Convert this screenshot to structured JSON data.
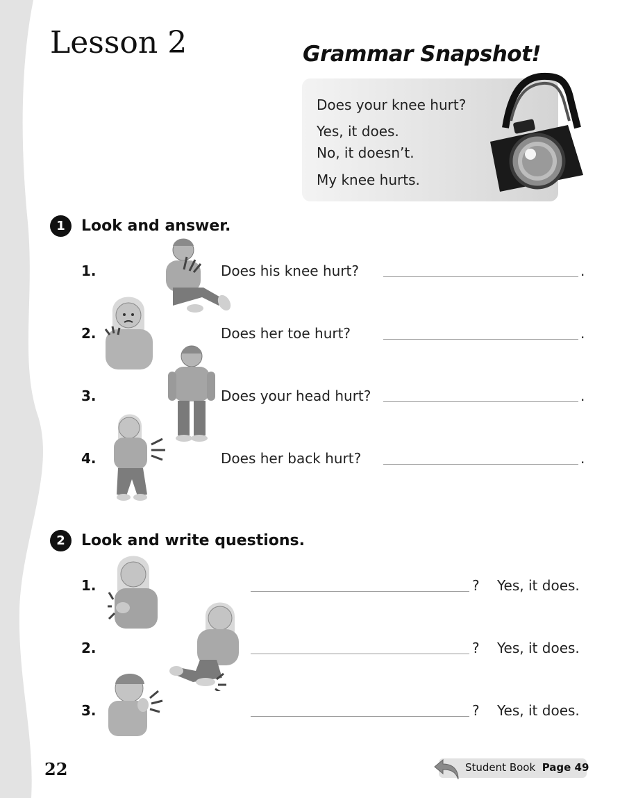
{
  "header": {
    "lesson_title": "Lesson 2",
    "snapshot_title": "Grammar Snapshot!"
  },
  "snapshot": {
    "lines": [
      "Does your knee hurt?",
      "Yes, it does.",
      "No, it doesn’t.",
      "My knee hurts."
    ]
  },
  "section1": {
    "number": "1",
    "title": "Look and answer.",
    "items": [
      {
        "num": "1.",
        "question": "Does his knee hurt?",
        "end": "."
      },
      {
        "num": "2.",
        "question": "Does her toe hurt?",
        "end": "."
      },
      {
        "num": "3.",
        "question": "Does your head hurt?",
        "end": "."
      },
      {
        "num": "4.",
        "question": "Does her back hurt?",
        "end": "."
      }
    ]
  },
  "section2": {
    "number": "2",
    "title": "Look and write questions.",
    "items": [
      {
        "num": "1.",
        "qmark": "?",
        "answer": "Yes, it does."
      },
      {
        "num": "2.",
        "qmark": "?",
        "answer": "Yes, it does."
      },
      {
        "num": "3.",
        "qmark": "?",
        "answer": "Yes, it does."
      }
    ]
  },
  "footer": {
    "page_number": "22",
    "ref_book": "Student Book",
    "ref_page": "Page 49"
  }
}
